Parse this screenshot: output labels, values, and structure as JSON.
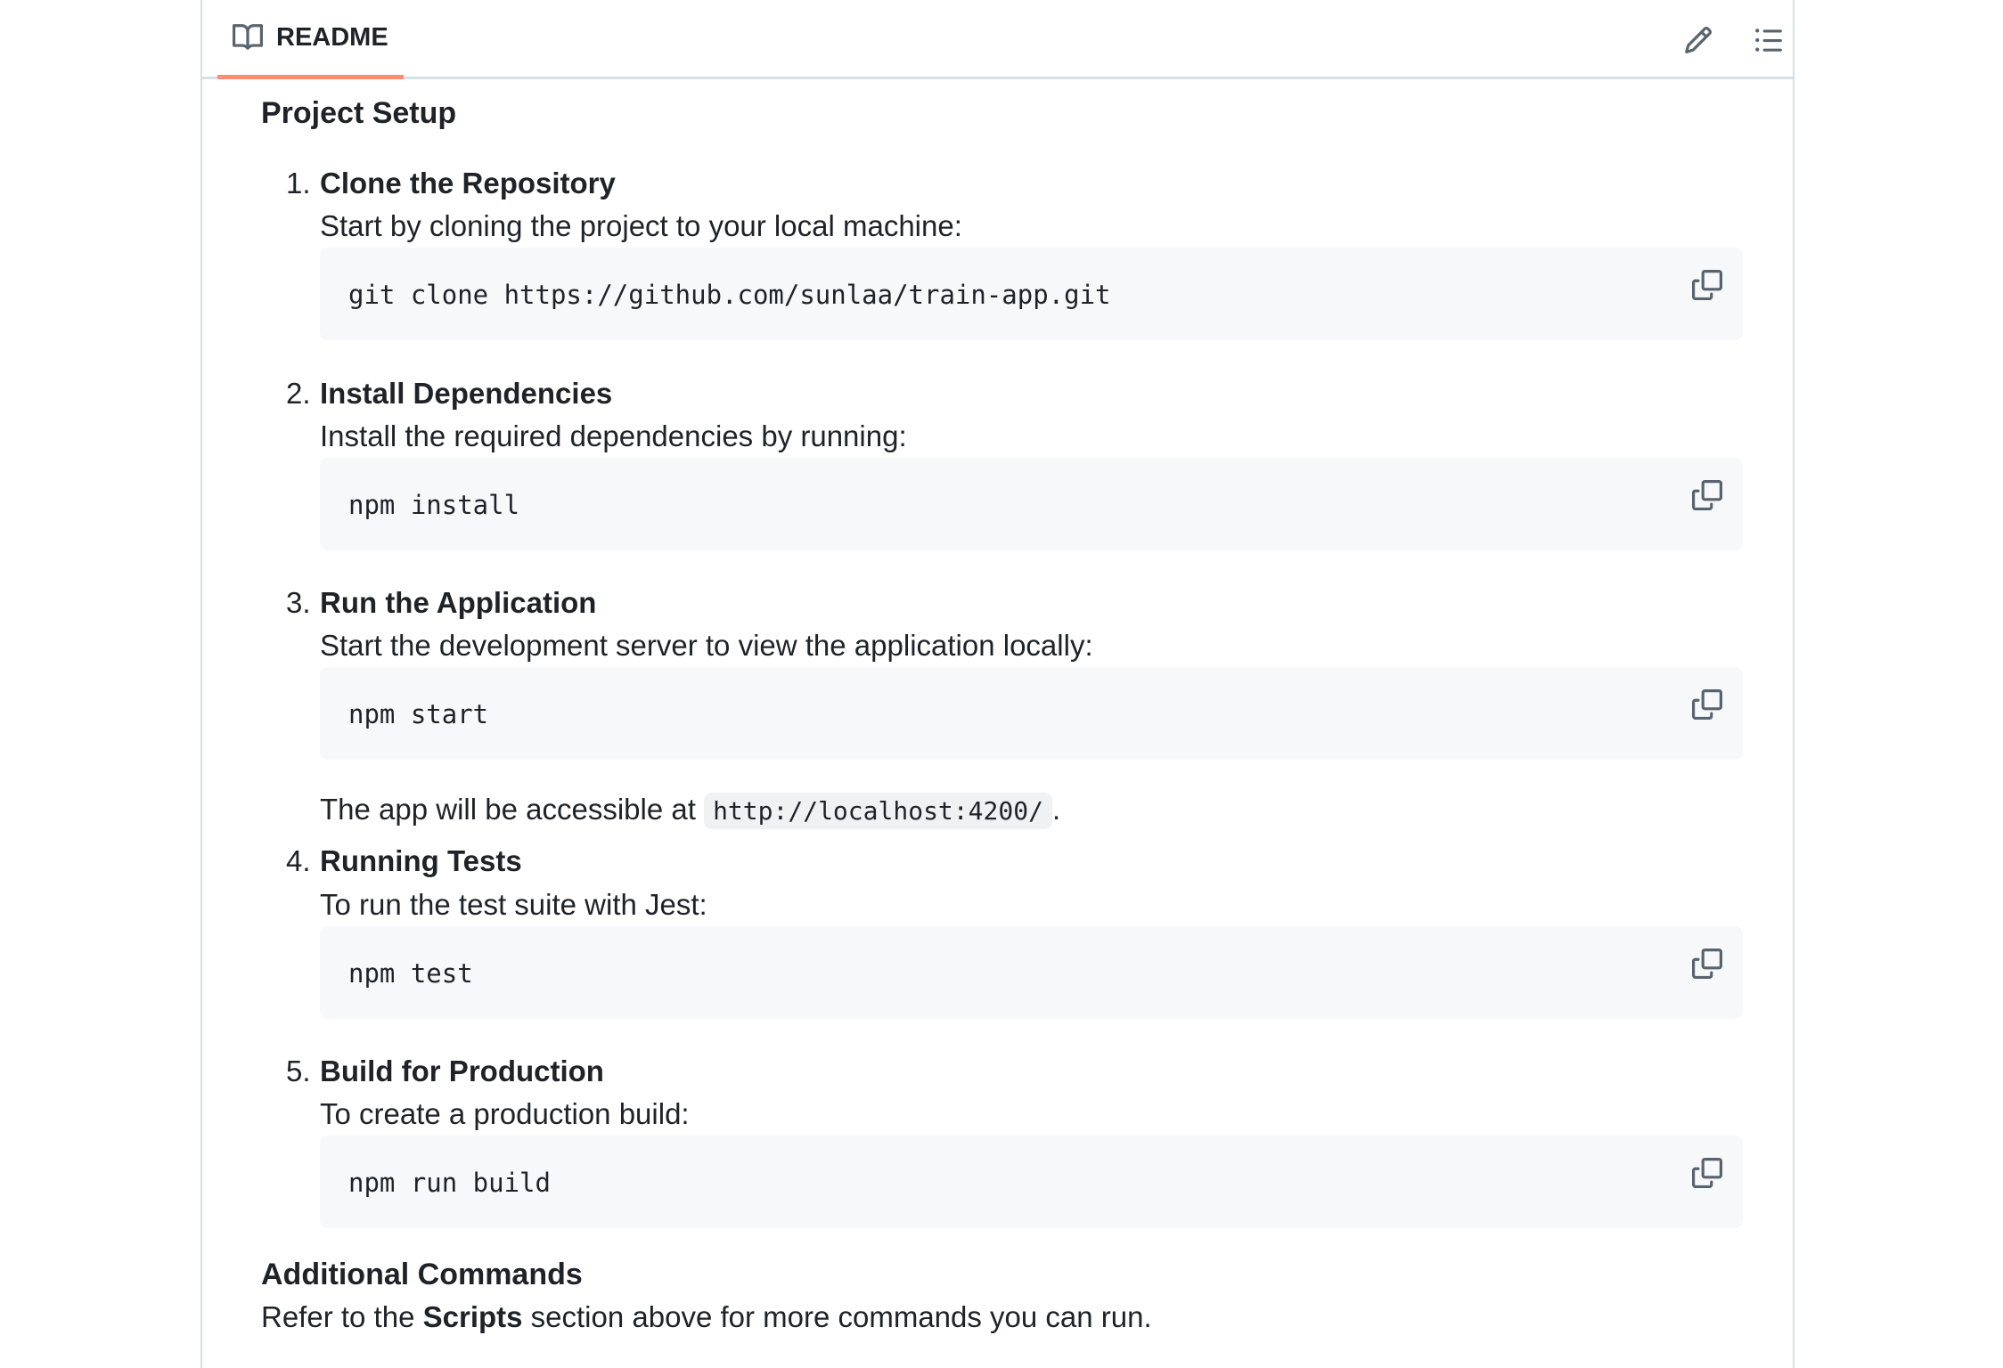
{
  "readme": {
    "tab_label": "README",
    "edit_icon": "pencil-icon",
    "outline_icon": "list-unordered-icon",
    "accent_color": "#fd8c73"
  },
  "content": {
    "heading": "Project Setup",
    "steps": [
      {
        "number": "1.",
        "title": "Clone the Repository",
        "description": "Start by cloning the project to your local machine:",
        "code": "git clone https://github.com/sunlaa/train-app.git"
      },
      {
        "number": "2.",
        "title": "Install Dependencies",
        "description": "Install the required dependencies by running:",
        "code": "npm install"
      },
      {
        "number": "3.",
        "title": "Run the Application",
        "description": "Start the development server to view the application locally:",
        "code": "npm start",
        "note_prefix": "The app will be accessible at ",
        "note_code": "http://localhost:4200/",
        "note_suffix": "."
      },
      {
        "number": "4.",
        "title": "Running Tests",
        "description": "To run the test suite with Jest:",
        "code": "npm test"
      },
      {
        "number": "5.",
        "title": "Build for Production",
        "description": "To create a production build:",
        "code": "npm run build"
      }
    ],
    "additional": {
      "heading": "Additional Commands",
      "text_prefix": "Refer to the ",
      "text_bold": "Scripts",
      "text_suffix": " section above for more commands you can run."
    }
  }
}
